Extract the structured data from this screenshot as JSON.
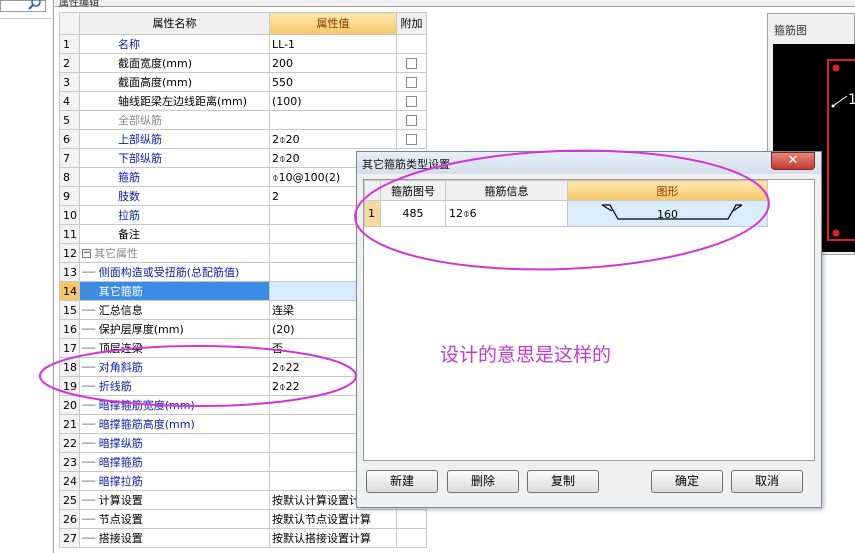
{
  "top_tab": {
    "label": "属性编辑"
  },
  "grid": {
    "headers": {
      "name": "属性名称",
      "value": "属性值",
      "extra": "附加"
    },
    "rows": [
      {
        "no": "1",
        "name": "名称",
        "value": "LL-1",
        "style": "blue",
        "check": false,
        "tree": ""
      },
      {
        "no": "2",
        "name": "截面宽度(mm)",
        "value": "200",
        "style": "",
        "check": true,
        "tree": ""
      },
      {
        "no": "3",
        "name": "截面高度(mm)",
        "value": "550",
        "style": "",
        "check": true,
        "tree": ""
      },
      {
        "no": "4",
        "name": "轴线距梁左边线距离(mm)",
        "value": "(100)",
        "style": "",
        "check": true,
        "tree": ""
      },
      {
        "no": "5",
        "name": "全部纵筋",
        "value": "",
        "style": "gray",
        "check": true,
        "tree": ""
      },
      {
        "no": "6",
        "name": "上部纵筋",
        "value": "2⌽20",
        "style": "blue",
        "check": true,
        "tree": ""
      },
      {
        "no": "7",
        "name": "下部纵筋",
        "value": "2⌽20",
        "style": "blue",
        "check": false,
        "tree": ""
      },
      {
        "no": "8",
        "name": "箍筋",
        "value": "⌽10@100(2)",
        "style": "blue",
        "check": false,
        "tree": ""
      },
      {
        "no": "9",
        "name": "肢数",
        "value": "2",
        "style": "blue",
        "check": false,
        "tree": ""
      },
      {
        "no": "10",
        "name": "拉筋",
        "value": "",
        "style": "blue",
        "check": false,
        "tree": ""
      },
      {
        "no": "11",
        "name": "备注",
        "value": "",
        "style": "",
        "check": false,
        "tree": ""
      },
      {
        "no": "12",
        "name": "其它属性",
        "value": "",
        "style": "gray",
        "check": false,
        "tree": "group"
      },
      {
        "no": "13",
        "name": "侧面构造或受扭筋(总配筋值)",
        "value": "",
        "style": "blue",
        "check": false,
        "tree": "child"
      },
      {
        "no": "14",
        "name": "其它箍筋",
        "value": "",
        "style": "",
        "check": false,
        "tree": "child",
        "selected": true
      },
      {
        "no": "15",
        "name": "汇总信息",
        "value": "连梁",
        "style": "",
        "check": false,
        "tree": "child"
      },
      {
        "no": "16",
        "name": "保护层厚度(mm)",
        "value": "(20)",
        "style": "",
        "check": false,
        "tree": "child"
      },
      {
        "no": "17",
        "name": "顶层连梁",
        "value": "否",
        "style": "",
        "check": false,
        "tree": "child"
      },
      {
        "no": "18",
        "name": "对角斜筋",
        "value": "2⌽22",
        "style": "blue",
        "check": false,
        "tree": "child"
      },
      {
        "no": "19",
        "name": "折线筋",
        "value": "2⌽22",
        "style": "blue",
        "check": false,
        "tree": "child"
      },
      {
        "no": "20",
        "name": "暗撑箍筋宽度(mm)",
        "value": "",
        "style": "blue",
        "check": false,
        "tree": "child"
      },
      {
        "no": "21",
        "name": "暗撑箍筋高度(mm)",
        "value": "",
        "style": "blue",
        "check": false,
        "tree": "child"
      },
      {
        "no": "22",
        "name": "暗撑纵筋",
        "value": "",
        "style": "blue",
        "check": false,
        "tree": "child"
      },
      {
        "no": "23",
        "name": "暗撑箍筋",
        "value": "",
        "style": "blue",
        "check": false,
        "tree": "child"
      },
      {
        "no": "24",
        "name": "暗撑拉筋",
        "value": "",
        "style": "blue",
        "check": false,
        "tree": "child"
      },
      {
        "no": "25",
        "name": "计算设置",
        "value": "按默认计算设置计算",
        "style": "",
        "check": false,
        "tree": "child"
      },
      {
        "no": "26",
        "name": "节点设置",
        "value": "按默认节点设置计算",
        "style": "",
        "check": false,
        "tree": "child"
      },
      {
        "no": "27",
        "name": "搭接设置",
        "value": "按默认搭接设置计算",
        "style": "",
        "check": false,
        "tree": "child"
      }
    ]
  },
  "preview": {
    "title": "箍筋图",
    "dimension_label": "1"
  },
  "dialog": {
    "title": "其它箍筋类型设置",
    "close_label": "✕",
    "table": {
      "headers": {
        "code": "箍筋图号",
        "info": "箍筋信息",
        "shape": "图形"
      },
      "row": {
        "no": "1",
        "code": "485",
        "info": "12⌽6",
        "shape_value": "160"
      }
    },
    "note": "设计的意思是这样的",
    "buttons": {
      "new": "新建",
      "delete": "删除",
      "copy": "复制",
      "ok": "确定",
      "cancel": "取消"
    }
  },
  "colors": {
    "annotation": "#d433d9",
    "header_accent": "#f6c768",
    "selection": "#3c8ce6"
  }
}
